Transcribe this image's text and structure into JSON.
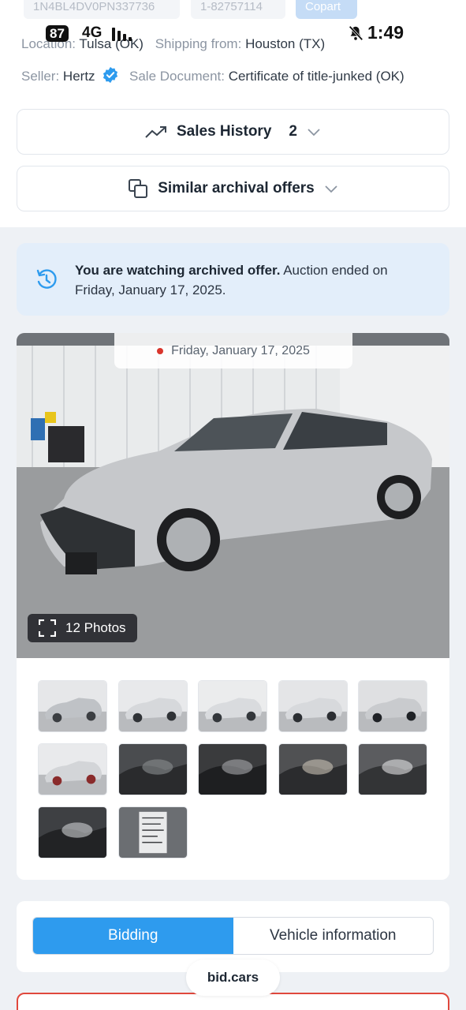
{
  "chips": {
    "vin": "1N4BL4DV0PN337736",
    "lot": "1-82757114",
    "source": "Copart"
  },
  "status_bar": {
    "battery": "87",
    "network": "4G",
    "time": "1:49"
  },
  "details": {
    "location_label": "Location:",
    "location_value": "Tulsa (OK)",
    "shipping_label": "Shipping from:",
    "shipping_value": "Houston (TX)",
    "seller_label": "Seller:",
    "seller_value": "Hertz",
    "sale_doc_label": "Sale Document:",
    "sale_doc_value": "Certificate of title-junked (OK)"
  },
  "sales_history": {
    "label": "Sales History",
    "count": "2"
  },
  "similar_offers": {
    "label": "Similar archival offers"
  },
  "notice": {
    "bold": "You are watching archived offer.",
    "rest": " Auction ended on Friday, January 17, 2025."
  },
  "gallery": {
    "date": "Friday, January 17, 2025",
    "photo_count": "12 Photos",
    "thumbnails": [
      "car-front-left",
      "car-side-left",
      "car-front-quarter",
      "car-side",
      "car-front",
      "car-rear",
      "interior-driver",
      "interior-dash",
      "interior-airbag",
      "interior-seats",
      "engine-bay",
      "window-sticker"
    ]
  },
  "tabs": {
    "bidding": "Bidding",
    "vehicle_info": "Vehicle information"
  },
  "site": "bid.cars",
  "colors": {
    "accent": "#2e9bee",
    "notice_bg": "#e3eefa",
    "alert": "#e0483d"
  }
}
